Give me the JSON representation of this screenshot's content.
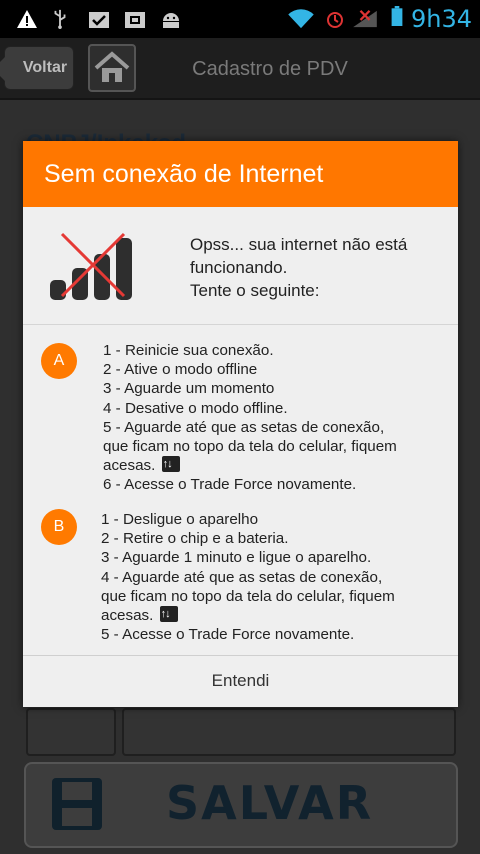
{
  "status_bar": {
    "time": "9h34",
    "icons": [
      "warning-icon",
      "usb-icon",
      "clipboard-check-icon",
      "photo-icon",
      "android-icon",
      "wifi-icon",
      "alarm-icon",
      "signal-icon",
      "battery-icon"
    ]
  },
  "header": {
    "back_label": "Voltar",
    "title": "Cadastro de PDV"
  },
  "background": {
    "partial_title": "CNPJ/Inkaksd",
    "save_label": "SALVAR"
  },
  "dialog": {
    "title": "Sem conexão de Internet",
    "message_line1": "Opss... sua internet não está",
    "message_line2": "funcionando.",
    "message_line3": "Tente o seguinte:",
    "section_a": {
      "badge": "A",
      "steps": [
        "1 - Reinicie sua conexão.",
        "2 - Ative o modo offline",
        "3 - Aguarde um momento",
        "4 - Desative o modo offline.",
        "5 - Aguarde até que as setas de conexão,",
        "que ficam no topo da tela do celular, fiquem",
        "acesas.",
        "6 - Acesse o Trade Force novamente."
      ]
    },
    "section_b": {
      "badge": "B",
      "steps": [
        "1 - Desligue o aparelho",
        "2 - Retire o chip e a bateria.",
        "3 - Aguarde 1 minuto e ligue o aparelho.",
        "4 - Aguarde até que as setas de conexão,",
        "que ficam no topo da tela do celular, fiquem",
        "acesas.",
        "5 - Acesse o Trade Force novamente."
      ]
    },
    "button_label": "Entendi"
  },
  "colors": {
    "accent": "#ff7700",
    "status_time": "#33b5e5"
  }
}
